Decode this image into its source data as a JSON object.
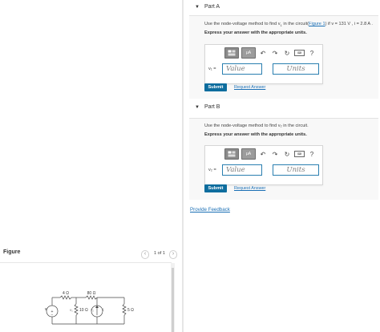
{
  "part_a": {
    "title": "Part A",
    "prompt_prefix": "Use the node-voltage method to find v",
    "prompt_sub": "1",
    "prompt_middle": " in the circuit(",
    "figure_link": "Figure 1",
    "prompt_suffix": ") if v = 131 V , i = 2.8 A .",
    "instruction": "Express your answer with the appropriate units.",
    "var_label": "v₁ =",
    "value_placeholder": "Value",
    "units_placeholder": "Units",
    "submit_label": "Submit",
    "request_label": "Request Answer"
  },
  "part_b": {
    "title": "Part B",
    "prompt": "Use the node-voltage method to find v₂ in the circuit.",
    "instruction": "Express your answer with the appropriate units.",
    "var_label": "v₂ =",
    "value_placeholder": "Value",
    "units_placeholder": "Units",
    "submit_label": "Submit",
    "request_label": "Request Answer"
  },
  "toolbar": {
    "template_icon": "template-icon",
    "mu_label": "μA",
    "undo_icon": "undo-icon",
    "redo_icon": "redo-icon",
    "reset_icon": "reset-icon",
    "keyboard_label": "keyboard",
    "help_label": "?"
  },
  "feedback_label": "Provide Feedback",
  "figure": {
    "label": "Figure",
    "page_indicator": "1 of 1",
    "prev_icon": "chevron-left-icon",
    "next_icon": "chevron-right-icon",
    "labels": {
      "r1": "4 Ω",
      "r2": "80 Ω",
      "r3": "10 Ω",
      "r4": "5 Ω",
      "v1": "v₁",
      "v2": "v₂",
      "vsrc": "v",
      "isrc": "i"
    }
  },
  "colors": {
    "accent": "#0e6d9e",
    "link": "#1a6fb5",
    "input_border": "#2a7fb0"
  }
}
